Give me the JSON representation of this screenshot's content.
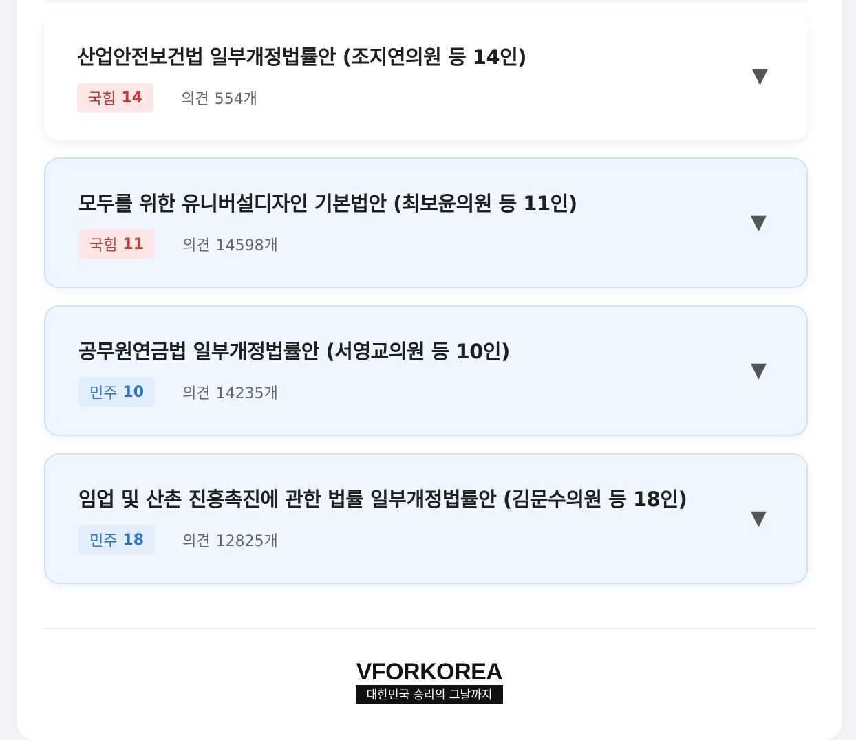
{
  "bills": [
    {
      "title": "산업안전보건법 일부개정법률안 (조지연의원 등 14인)",
      "party": "국힘",
      "party_count": "14",
      "opinion_label": "의견",
      "opinion_count": "554개",
      "chevron": "▼"
    },
    {
      "title": "모두를 위한 유니버설디자인 기본법안 (최보윤의원 등 11인)",
      "party": "국힘",
      "party_count": "11",
      "opinion_label": "의견",
      "opinion_count": "14598개",
      "chevron": "▼"
    },
    {
      "title": "공무원연금법 일부개정법률안 (서영교의원 등 10인)",
      "party": "민주",
      "party_count": "10",
      "opinion_label": "의견",
      "opinion_count": "14235개",
      "chevron": "▼"
    },
    {
      "title": "임업 및 산촌 진흥촉진에 관한 법률 일부개정법률안 (김문수의원 등 18인)",
      "party": "민주",
      "party_count": "18",
      "opinion_label": "의견",
      "opinion_count": "12825개",
      "chevron": "▼"
    }
  ],
  "footer": {
    "logo_main": "VFORKOREA",
    "logo_sub": "대한민국 승리의 그날까지"
  },
  "colors": {
    "party_ppp_bg": "#fde6e6",
    "party_ppp_text": "#c63b3b",
    "party_dem_bg": "#e2effb",
    "party_dem_text": "#2f74c4",
    "card_tint": "#eff6ff"
  }
}
